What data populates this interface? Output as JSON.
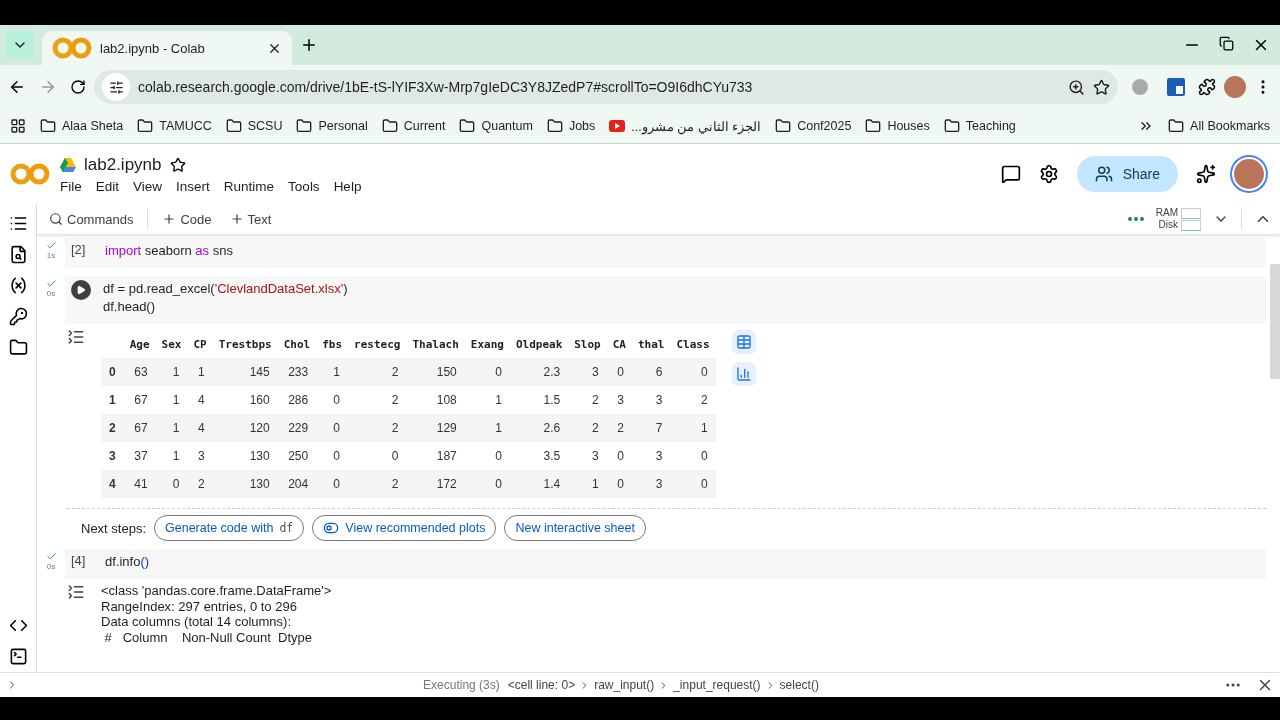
{
  "browser": {
    "tab": {
      "title": "lab2.ipynb - Colab",
      "selected": true
    },
    "url": "colab.research.google.com/drive/1bE-tS-lYIF3Xw-Mrp7gIeDC3Y8JZedP7#scrollTo=O9I6dhCYu733",
    "bookmarks": [
      {
        "label": "Alaa Sheta",
        "kind": "folder"
      },
      {
        "label": "TAMUCC",
        "kind": "folder"
      },
      {
        "label": "SCSU",
        "kind": "folder"
      },
      {
        "label": "Personal",
        "kind": "folder"
      },
      {
        "label": "Current",
        "kind": "folder"
      },
      {
        "label": "Quantum",
        "kind": "folder"
      },
      {
        "label": "Jobs",
        "kind": "folder"
      },
      {
        "label": "الجزء الثاني من مشرو...",
        "kind": "video"
      },
      {
        "label": "Conf2025",
        "kind": "folder"
      },
      {
        "label": "Houses",
        "kind": "folder"
      },
      {
        "label": "Teaching",
        "kind": "folder"
      }
    ],
    "all_bookmarks": "All Bookmarks"
  },
  "notebook": {
    "file_name": "lab2.ipynb",
    "menu": [
      "File",
      "Edit",
      "View",
      "Insert",
      "Runtime",
      "Tools",
      "Help"
    ],
    "share": "Share",
    "toolbar": {
      "commands": "Commands",
      "add_code": "Code",
      "add_text": "Text"
    },
    "resources": [
      "RAM",
      "Disk"
    ]
  },
  "cells": [
    {
      "count": "[2]",
      "hovered": false,
      "time": "1s",
      "code": [
        [
          {
            "kind": "keyword",
            "text": "import"
          },
          {
            "kind": "plain",
            "text": " seaborn "
          },
          {
            "kind": "keyword",
            "text": "as"
          },
          {
            "kind": "plain",
            "text": " sns"
          }
        ]
      ]
    },
    {
      "hovered": true,
      "time": "0s",
      "code": [
        [
          {
            "kind": "plain",
            "text": "df = pd.read_excel("
          },
          {
            "kind": "string",
            "text": "'ClevlandDataSet.xlsx'"
          },
          {
            "kind": "plain",
            "text": ")"
          }
        ],
        [
          {
            "kind": "plain",
            "text": "df.head()"
          }
        ]
      ],
      "output": {
        "kind": "dataframe",
        "columns": [
          "Age",
          "Sex",
          "CP",
          "Trestbps",
          "Chol",
          "fbs",
          "restecg",
          "Thalach",
          "Exang",
          "Oldpeak",
          "Slop",
          "CA",
          "thal",
          "Class"
        ],
        "rows": [
          {
            "index": "0",
            "values": [
              "63",
              "1",
              "1",
              "145",
              "233",
              "1",
              "2",
              "150",
              "0",
              "2.3",
              "3",
              "0",
              "6",
              "0"
            ]
          },
          {
            "index": "1",
            "values": [
              "67",
              "1",
              "4",
              "160",
              "286",
              "0",
              "2",
              "108",
              "1",
              "1.5",
              "2",
              "3",
              "3",
              "2"
            ]
          },
          {
            "index": "2",
            "values": [
              "67",
              "1",
              "4",
              "120",
              "229",
              "0",
              "2",
              "129",
              "1",
              "2.6",
              "2",
              "2",
              "7",
              "1"
            ]
          },
          {
            "index": "3",
            "values": [
              "37",
              "1",
              "3",
              "130",
              "250",
              "0",
              "0",
              "187",
              "0",
              "3.5",
              "3",
              "0",
              "3",
              "0"
            ]
          },
          {
            "index": "4",
            "values": [
              "41",
              "0",
              "2",
              "130",
              "204",
              "0",
              "2",
              "172",
              "0",
              "1.4",
              "1",
              "0",
              "3",
              "0"
            ]
          }
        ],
        "next_steps": {
          "label": "Next steps:",
          "buttons": [
            {
              "kind": "code",
              "text": "Generate code with",
              "code": "df"
            },
            {
              "kind": "icon",
              "text": "View recommended plots"
            },
            {
              "kind": "plain",
              "text": "New interactive sheet"
            }
          ]
        }
      }
    },
    {
      "count": "[4]",
      "hovered": false,
      "time": "0s",
      "code": [
        [
          {
            "kind": "plain",
            "text": "df.info"
          },
          {
            "kind": "paren",
            "text": "()"
          }
        ]
      ],
      "output": {
        "kind": "text",
        "lines": [
          "<class 'pandas.core.frame.DataFrame'>",
          "RangeIndex: 297 entries, 0 to 296",
          "Data columns (total 14 columns):",
          " #   Column    Non-Null Count  Dtype"
        ]
      }
    }
  ],
  "status_bar": {
    "state": "Executing (3s)",
    "trace": [
      "<cell line: 0>",
      "raw_input()",
      "_input_request()",
      "select()"
    ]
  }
}
